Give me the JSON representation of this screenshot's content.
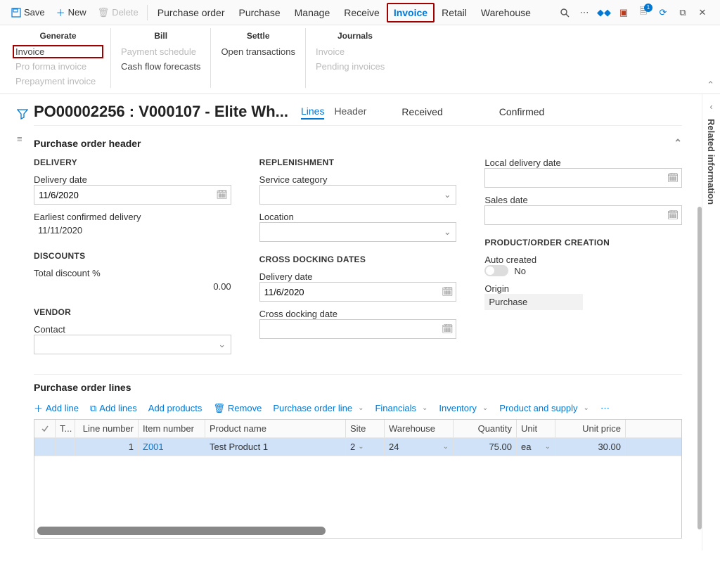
{
  "topbar": {
    "save": "Save",
    "new": "New",
    "delete": "Delete",
    "tabs": [
      "Purchase order",
      "Purchase",
      "Manage",
      "Receive",
      "Invoice",
      "Retail",
      "Warehouse"
    ],
    "activeTab": "Invoice",
    "notif_count": "1"
  },
  "ribbon": {
    "groups": [
      {
        "title": "Generate",
        "items": [
          {
            "label": "Invoice",
            "hl": true
          },
          {
            "label": "Pro forma invoice",
            "disabled": true
          },
          {
            "label": "Prepayment invoice",
            "disabled": true
          }
        ]
      },
      {
        "title": "Bill",
        "items": [
          {
            "label": "Payment schedule",
            "disabled": true
          },
          {
            "label": "Cash flow forecasts"
          }
        ]
      },
      {
        "title": "Settle",
        "items": [
          {
            "label": "Open transactions"
          }
        ]
      },
      {
        "title": "Journals",
        "items": [
          {
            "label": "Invoice",
            "disabled": true
          },
          {
            "label": "Pending invoices",
            "disabled": true
          }
        ]
      }
    ]
  },
  "page": {
    "title": "PO00002256 : V000107 - Elite Wh...",
    "viewtabs": {
      "lines": "Lines",
      "header": "Header"
    },
    "status1": "Received",
    "status2": "Confirmed",
    "side_label": "Related information"
  },
  "fasttab": {
    "header": "Purchase order header",
    "delivery": {
      "title": "DELIVERY",
      "date_label": "Delivery date",
      "date": "11/6/2020",
      "ecd_label": "Earliest confirmed delivery",
      "ecd": "11/11/2020"
    },
    "discounts": {
      "title": "DISCOUNTS",
      "td_label": "Total discount %",
      "td": "0.00"
    },
    "vendor": {
      "title": "VENDOR",
      "contact_label": "Contact"
    },
    "replen": {
      "title": "REPLENISHMENT",
      "svc_label": "Service category",
      "loc_label": "Location"
    },
    "cross": {
      "title": "CROSS DOCKING DATES",
      "d_label": "Delivery date",
      "d": "11/6/2020",
      "c_label": "Cross docking date"
    },
    "local": {
      "ldd_label": "Local delivery date",
      "sd_label": "Sales date"
    },
    "poc": {
      "title": "PRODUCT/ORDER CREATION",
      "auto_label": "Auto created",
      "auto_val": "No",
      "origin_label": "Origin",
      "origin_val": "Purchase"
    }
  },
  "grid": {
    "section": "Purchase order lines",
    "toolbar": {
      "add_line": "Add line",
      "add_lines": "Add lines",
      "add_products": "Add products",
      "remove": "Remove",
      "pol": "Purchase order line",
      "fin": "Financials",
      "inv": "Inventory",
      "pas": "Product and supply"
    },
    "cols": {
      "t": "T...",
      "ln": "Line number",
      "item": "Item number",
      "prod": "Product name",
      "site": "Site",
      "wh": "Warehouse",
      "qty": "Quantity",
      "unit": "Unit",
      "price": "Unit price"
    },
    "row": {
      "ln": "1",
      "item": "Z001",
      "prod": "Test Product 1",
      "site": "2",
      "wh": "24",
      "qty": "75.00",
      "unit": "ea",
      "price": "30.00"
    }
  }
}
